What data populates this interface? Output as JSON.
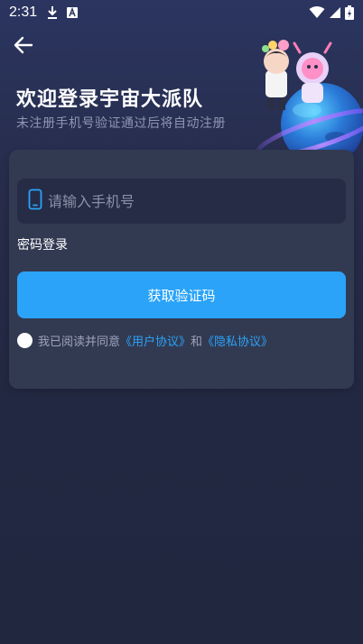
{
  "status_bar": {
    "time": "2:31",
    "icons": [
      "download-icon",
      "a-box-icon",
      "wifi-icon",
      "signal-icon",
      "battery-icon"
    ]
  },
  "header": {
    "back_icon": "arrow-left-icon",
    "title": "欢迎登录宇宙大派队",
    "subtitle": "未注册手机号验证通过后将自动注册"
  },
  "form": {
    "phone_icon": "phone-icon",
    "phone_placeholder": "请输入手机号",
    "phone_value": "",
    "password_login_label": "密码登录",
    "submit_label": "获取验证码",
    "agreement_prefix": "我已阅读并同意",
    "user_agreement_link": "《用户协议》",
    "agreement_and": "和",
    "privacy_policy_link": "《隐私协议》"
  },
  "colors": {
    "accent": "#2aa3f9",
    "background": "#232842",
    "card": "#323a52",
    "input_bg": "#262c45",
    "muted_text": "#8f96b3"
  }
}
